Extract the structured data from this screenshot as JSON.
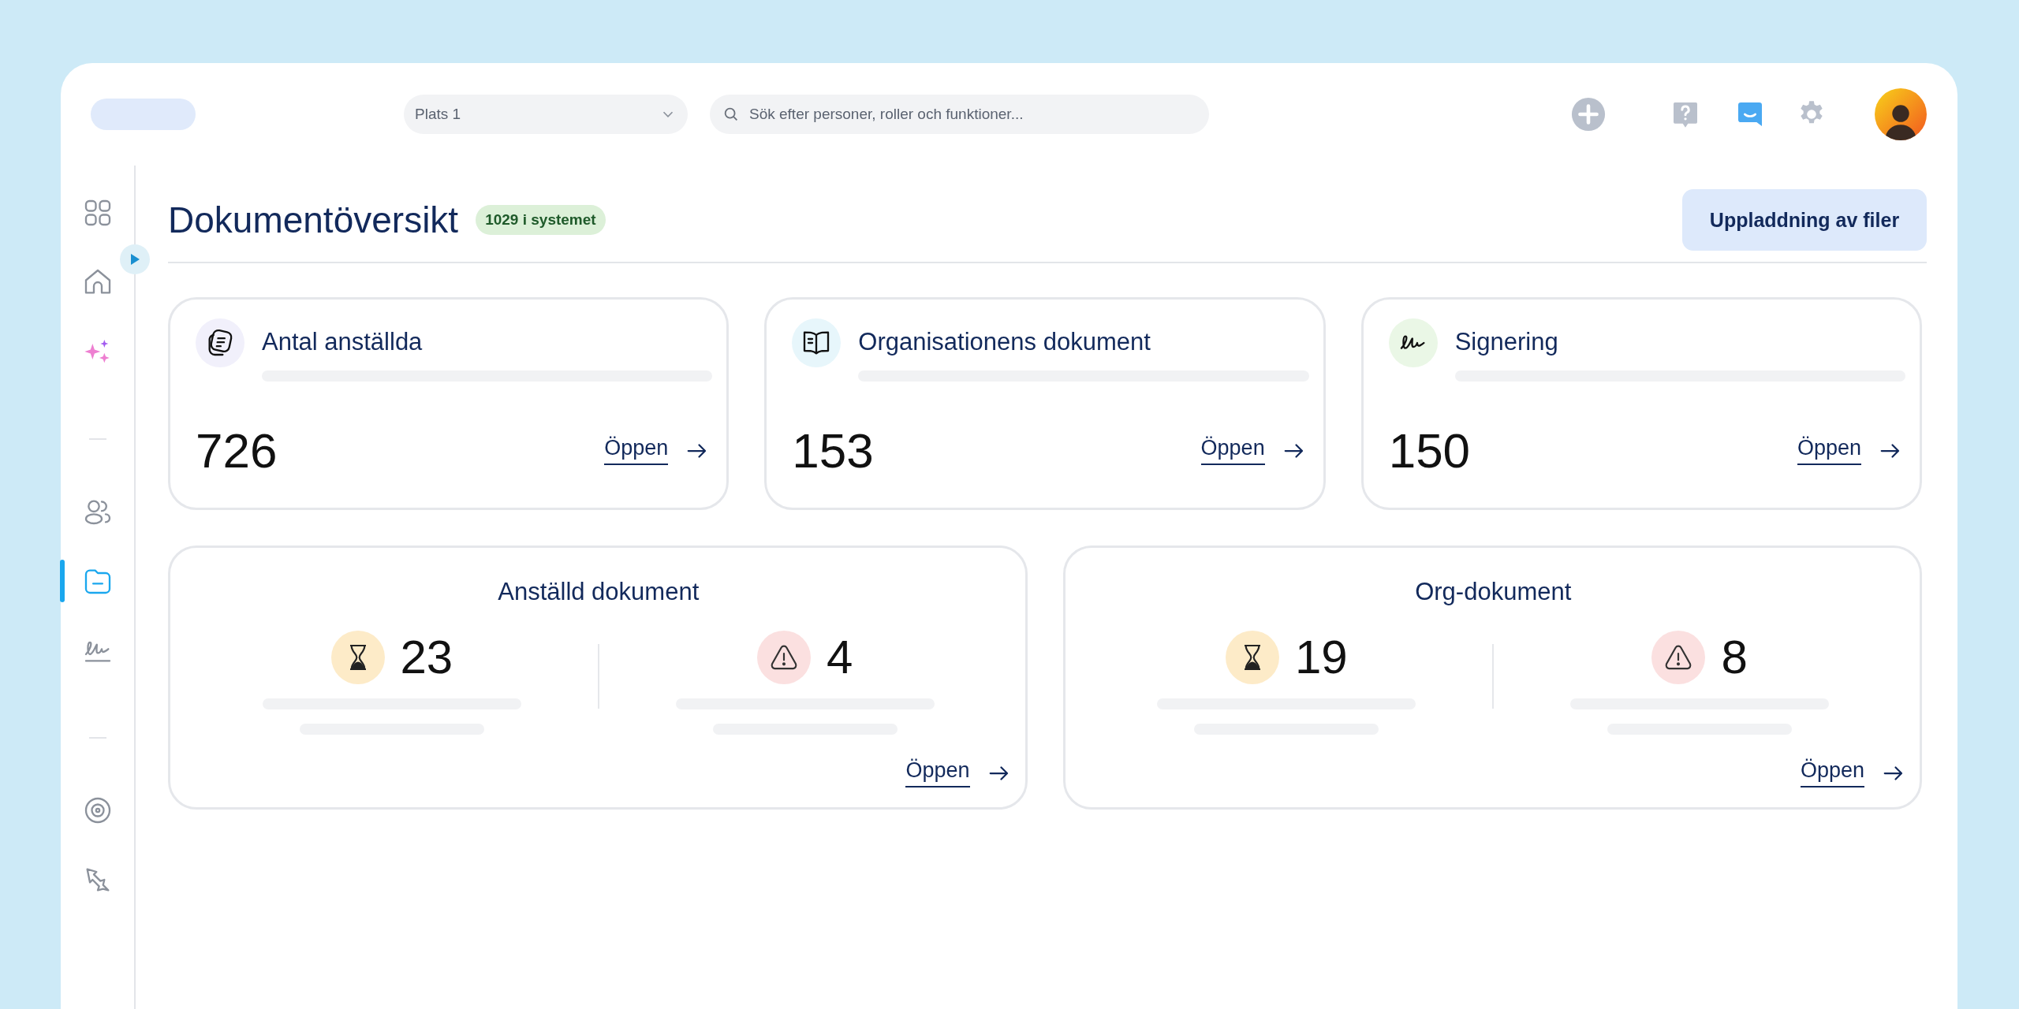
{
  "top_bar": {
    "location_select": {
      "value": "Plats 1"
    },
    "search": {
      "placeholder": "Sök efter personer, roller och funktioner..."
    }
  },
  "sidebar": {
    "items": [
      {
        "kind": "apps",
        "selected": false
      },
      {
        "kind": "home",
        "selected": false
      },
      {
        "kind": "sparkles",
        "selected": false
      },
      {
        "kind": "divider"
      },
      {
        "kind": "people",
        "selected": false
      },
      {
        "kind": "folder",
        "selected": true
      },
      {
        "kind": "signature",
        "selected": false
      },
      {
        "kind": "divider"
      },
      {
        "kind": "target",
        "selected": false
      },
      {
        "kind": "cursor",
        "selected": false
      }
    ]
  },
  "page": {
    "title": "Dokumentöversikt",
    "count_badge": "1029 i systemet",
    "upload_button": "Uppladdning av filer"
  },
  "stat_cards": [
    {
      "kind": "employees",
      "title": "Antal anställda",
      "value": "726",
      "link": "Öppen"
    },
    {
      "kind": "organisation",
      "title": "Organisationens dokument",
      "value": "153",
      "link": "Öppen"
    },
    {
      "kind": "signing",
      "title": "Signering",
      "value": "150",
      "link": "Öppen"
    }
  ],
  "summary_cards": [
    {
      "title": "Anställd dokument",
      "pending": "23",
      "warnings": "4",
      "link": "Öppen"
    },
    {
      "title": "Org-dokument",
      "pending": "19",
      "warnings": "8",
      "link": "Öppen"
    }
  ]
}
